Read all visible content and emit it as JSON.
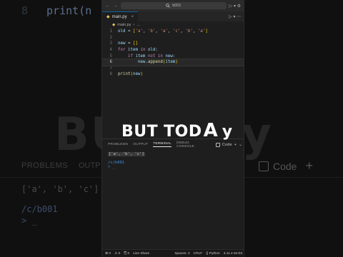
{
  "background": {
    "code_line_number": "8",
    "code_fn": "print(n",
    "big_text_left": "BU",
    "big_text_right": "y",
    "problems": "PROBLEMS",
    "output": "OUTP",
    "code_label": "Code",
    "term_output": "['a', 'b', 'c']",
    "term_path": "/c/b001",
    "term_prompt": "> _"
  },
  "titlebar": {
    "back": "←",
    "forward": "→",
    "search_text": "b001",
    "right_icons": "▷ ▾ ⚙"
  },
  "tab": {
    "label": "main.py",
    "close": "×"
  },
  "editor_controls": "▷ ▾ ⋯",
  "breadcrumb": {
    "file": "main.py",
    "sep": "›",
    "rest": "..."
  },
  "code_lines": [
    {
      "n": "1",
      "text": "old = ['a', 'b', 'a', 'c', 'b', 'a']"
    },
    {
      "n": "2",
      "text": ""
    },
    {
      "n": "3",
      "text": "new = []"
    },
    {
      "n": "4",
      "text": "for item in old:"
    },
    {
      "n": "5",
      "text": "    if item not in new:"
    },
    {
      "n": "6",
      "text": "        new.append(item)"
    },
    {
      "n": "7",
      "text": ""
    },
    {
      "n": "8",
      "text": "print(new)"
    }
  ],
  "caption": {
    "word1": "BUT",
    "word2": "TOD",
    "letter_a": "A",
    "letter_y": "y"
  },
  "panel": {
    "tabs": [
      "PROBLEMS",
      "OUTPUT",
      "TERMINAL",
      "DEBUG CONSOLE"
    ],
    "active_tab": "TERMINAL",
    "code_label": "Code",
    "add": "+",
    "chevron": "⌄",
    "terminal_output": "['a', 'b', 'c']",
    "terminal_path": "/c/b001",
    "terminal_prompt": "> _"
  },
  "statusbar": {
    "errors": "⊗ 0",
    "warnings": "⚠ 0",
    "ports": "⎘ 0",
    "live_share": "Live Share",
    "spaces": "Spaces: 4",
    "eol": "CRLF",
    "language": "{} Python",
    "version": "3.11.4 64-bit"
  },
  "colors": {
    "editor_bg": "#1e1e1e",
    "keyword": "#c586c0",
    "variable": "#9cdcfe",
    "string": "#ce9178",
    "function": "#dcdcaa",
    "terminal_path": "#3b8eea"
  }
}
